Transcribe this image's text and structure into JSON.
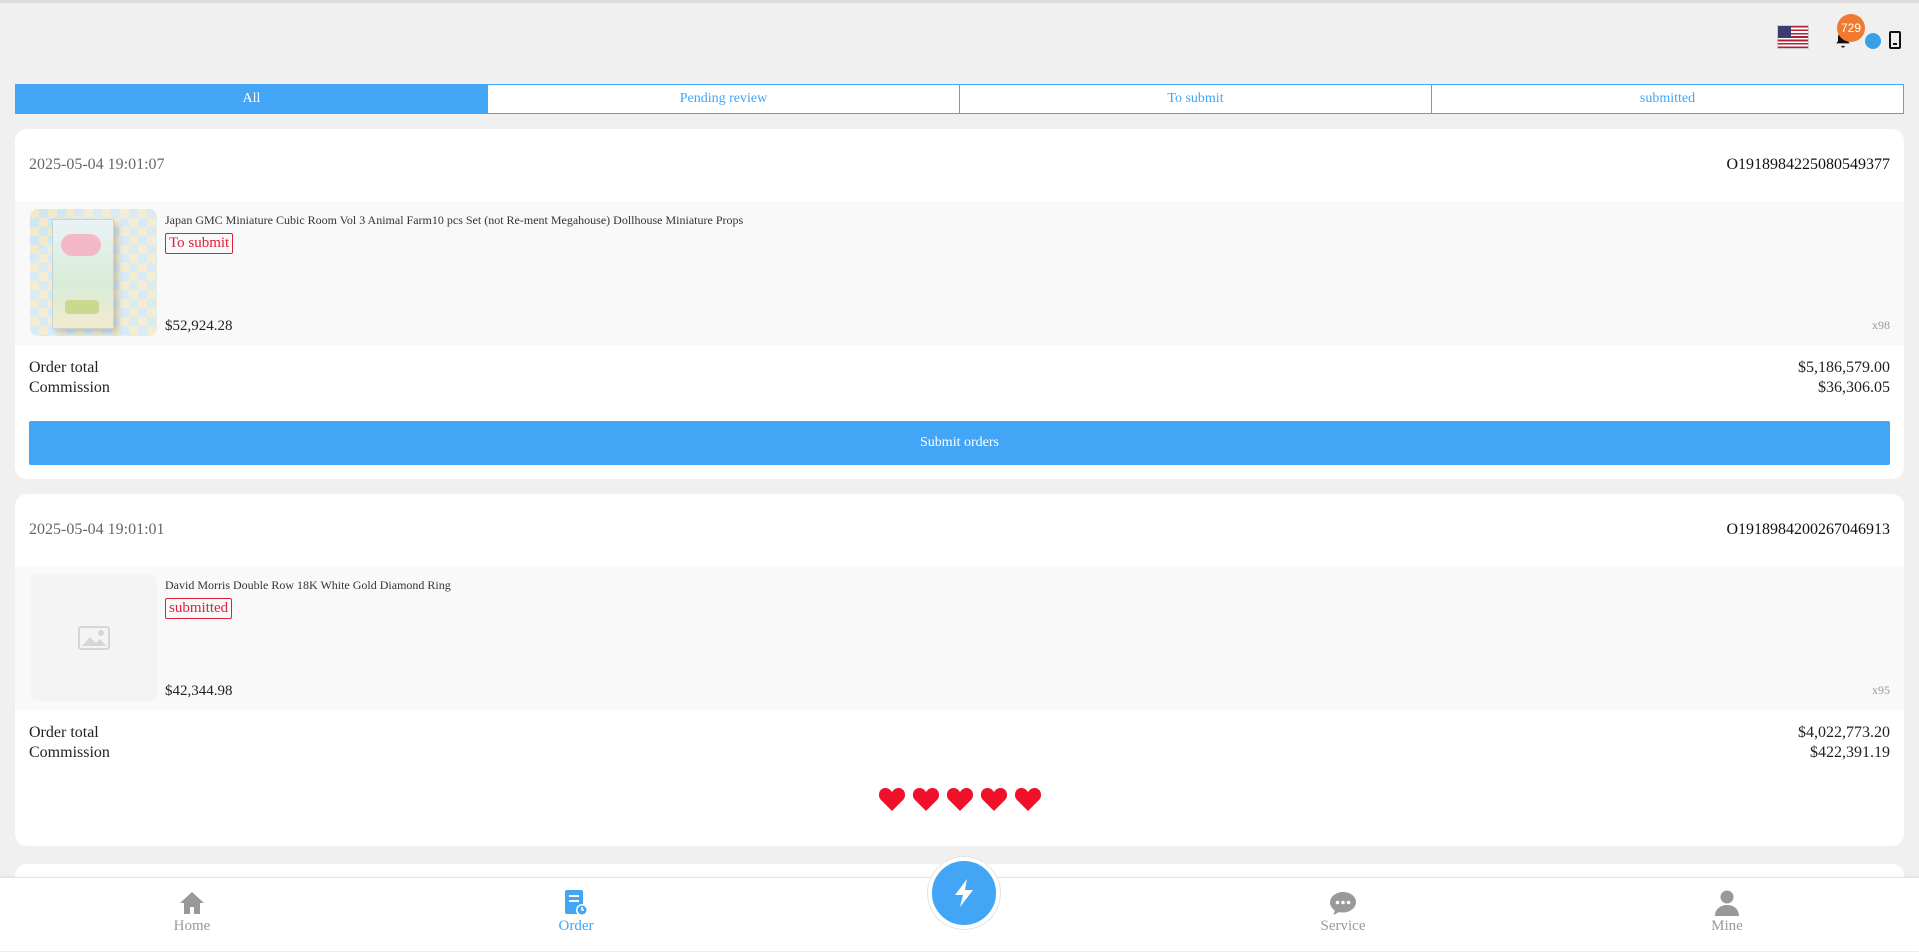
{
  "header": {
    "notification_count": "729",
    "flag_icon": "us-flag-icon",
    "bell_icon": "bell-icon",
    "service_icon": "customer-service-icon",
    "device_icon": "phone-icon"
  },
  "tabs": [
    {
      "label": "All",
      "active": true
    },
    {
      "label": "Pending review",
      "active": false
    },
    {
      "label": "To submit",
      "active": false
    },
    {
      "label": "submitted",
      "active": false
    }
  ],
  "orders": [
    {
      "date": "2025-05-04 19:01:07",
      "order_no": "O1918984225080549377",
      "product_title": "Japan GMC Miniature Cubic Room Vol 3 Animal Farm10 pcs Set (not Re-ment Megahouse) Dollhouse Miniature Props",
      "status": "To submit",
      "price": "$52,924.28",
      "quantity": "x98",
      "order_total_label": "Order total",
      "order_total": "$5,186,579.00",
      "commission_label": "Commission",
      "commission": "$36,306.05",
      "action_label": "Submit orders"
    },
    {
      "date": "2025-05-04 19:01:01",
      "order_no": "O1918984200267046913",
      "product_title": "David Morris Double Row 18K White Gold Diamond Ring",
      "status": "submitted",
      "price": "$42,344.98",
      "quantity": "x95",
      "order_total_label": "Order total",
      "order_total": "$4,022,773.20",
      "commission_label": "Commission",
      "commission": "$422,391.19",
      "rating": 5
    }
  ],
  "bottom_nav": [
    {
      "label": "Home",
      "icon": "home-icon",
      "active": false
    },
    {
      "label": "Order",
      "icon": "order-icon",
      "active": true
    },
    {
      "label": "Service",
      "icon": "chat-icon",
      "active": false
    },
    {
      "label": "Mine",
      "icon": "user-icon",
      "active": false
    }
  ],
  "center_button_icon": "lightning-icon",
  "colors": {
    "accent": "#42a5f5",
    "status_red": "#e0203a",
    "heart_red": "#f0102a",
    "badge_orange": "#f07a2d"
  }
}
